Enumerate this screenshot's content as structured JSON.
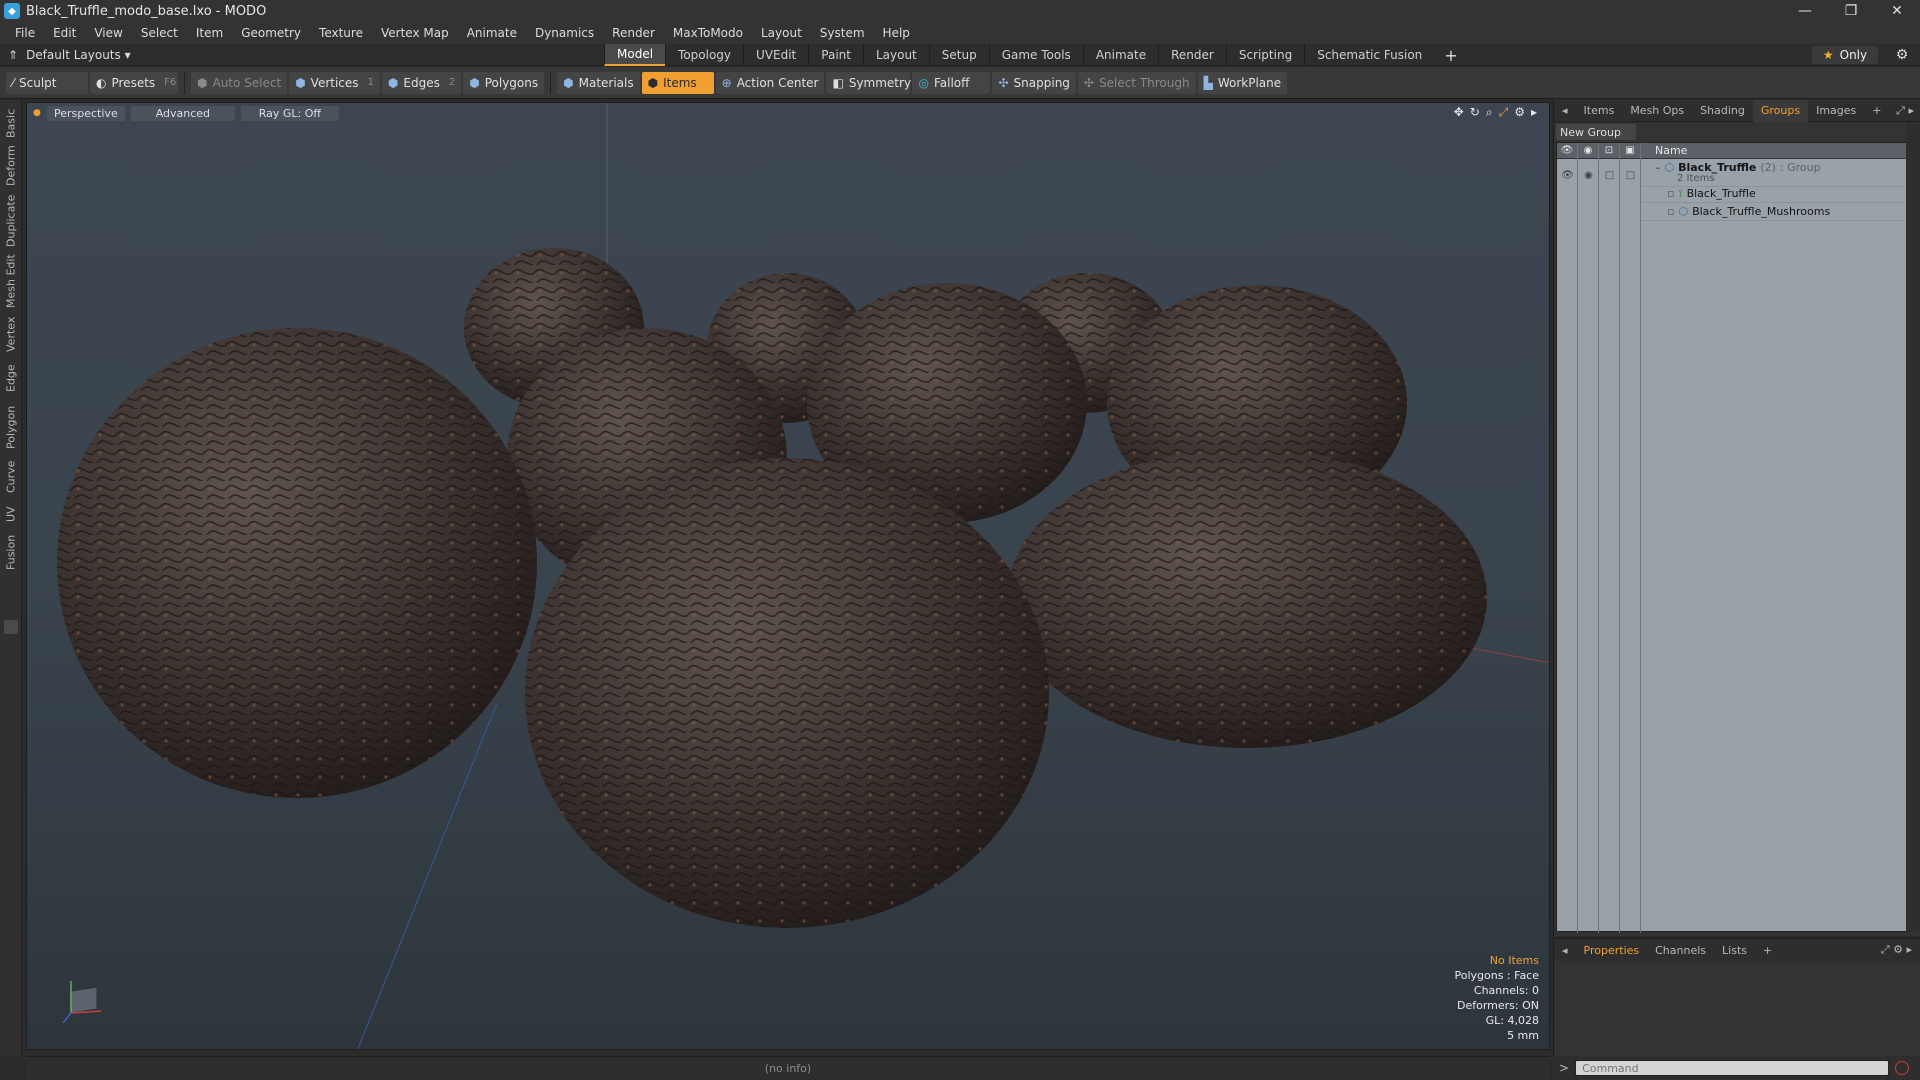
{
  "window": {
    "title": "Black_Truffle_modo_base.lxo - MODO",
    "controls": [
      "—",
      "❐",
      "✕"
    ]
  },
  "menu": [
    "File",
    "Edit",
    "View",
    "Select",
    "Item",
    "Geometry",
    "Texture",
    "Vertex Map",
    "Animate",
    "Dynamics",
    "Render",
    "MaxToModo",
    "Layout",
    "System",
    "Help"
  ],
  "layout": {
    "selector": "Default Layouts ▾",
    "tabs": [
      "Model",
      "Topology",
      "UVEdit",
      "Paint",
      "Layout",
      "Setup",
      "Game Tools",
      "Animate",
      "Render",
      "Scripting",
      "Schematic Fusion"
    ],
    "active_tab": "Model",
    "plus": "+",
    "only_label": "Only"
  },
  "toolbar": {
    "sculpt": "Sculpt",
    "presets": "Presets",
    "presets_key": "F6",
    "auto_select": "Auto Select",
    "vertices": "Vertices",
    "vertices_key": "1",
    "edges": "Edges",
    "edges_key": "2",
    "polygons": "Polygons",
    "materials": "Materials",
    "items": "Items",
    "action_center": "Action Center",
    "symmetry": "Symmetry",
    "falloff": "Falloff",
    "snapping": "Snapping",
    "select_through": "Select Through",
    "workplane": "WorkPlane"
  },
  "left_tabs": [
    "Basic",
    "Deform",
    "Duplicate",
    "Mesh Edit",
    "Vertex",
    "Edge",
    "Polygon",
    "Curve",
    "UV",
    "Fusion"
  ],
  "viewport": {
    "view": "Perspective",
    "shading": "Advanced",
    "raygl": "Ray GL: Off",
    "info": {
      "selection": "No Items",
      "polygons": "Polygons : Face",
      "channels": "Channels: 0",
      "deformers": "Deformers: ON",
      "gl": "GL: 4,028",
      "scale": "5 mm"
    }
  },
  "status": {
    "text": "(no info)"
  },
  "right_panel": {
    "tabs": [
      "Items",
      "Mesh Ops",
      "Shading",
      "Groups",
      "Images"
    ],
    "active_tab": "Groups",
    "new_group": "New Group",
    "column_name": "Name",
    "group": {
      "name": "Black_Truffle",
      "count": "(2)",
      "type": ": Group",
      "sub": "2 Items",
      "children": [
        "Black_Truffle",
        "Black_Truffle_Mushrooms"
      ]
    }
  },
  "properties_panel": {
    "tabs": [
      "Properties",
      "Channels",
      "Lists"
    ],
    "active_tab": "Properties"
  },
  "command": {
    "prompt": ">",
    "placeholder": "Command"
  }
}
